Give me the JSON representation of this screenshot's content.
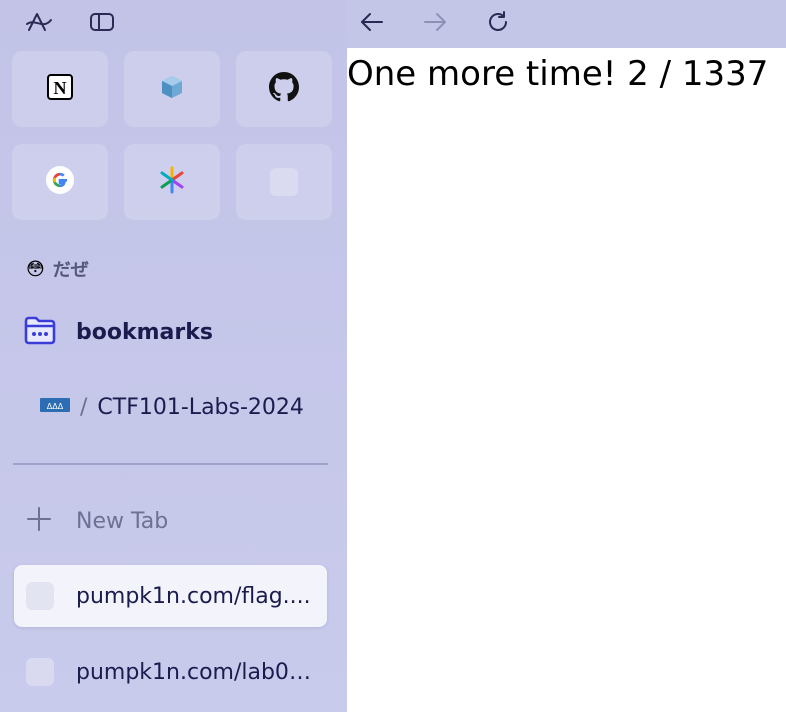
{
  "browser": {
    "toolbar": {
      "icons": [
        "arc-logo-icon",
        "sidebar-toggle-icon",
        "back-arrow-icon",
        "forward-arrow-icon",
        "reload-icon"
      ]
    },
    "pinned_tiles": [
      {
        "name": "notion",
        "icon": "notion-icon",
        "glyph": "N"
      },
      {
        "name": "box",
        "icon": "cube-icon"
      },
      {
        "name": "github",
        "icon": "github-icon"
      },
      {
        "name": "google",
        "icon": "google-icon",
        "glyph": "G"
      },
      {
        "name": "perplexity",
        "icon": "pinwheel-icon"
      },
      {
        "name": "empty",
        "icon": "blank-favicon-icon"
      }
    ],
    "space": {
      "emoji": "😳",
      "name": "だぜ"
    },
    "folder": {
      "icon": "folder-icon",
      "label": "bookmarks"
    },
    "breadcrumb": {
      "separator": "/",
      "label": "CTF101-Labs-2024"
    },
    "new_tab": {
      "icon": "plus-icon",
      "label": "New Tab"
    },
    "tabs": [
      {
        "title": "pumpk1n.com/flag....",
        "active": true
      },
      {
        "title": "pumpk1n.com/lab0....",
        "active": false
      }
    ],
    "colors": {
      "sidebar_bg": "#c2c3e7",
      "accent": "#3b3dd8",
      "text": "#1b1c4e"
    }
  },
  "page": {
    "content_text": "One more time! 2 / 1337"
  }
}
